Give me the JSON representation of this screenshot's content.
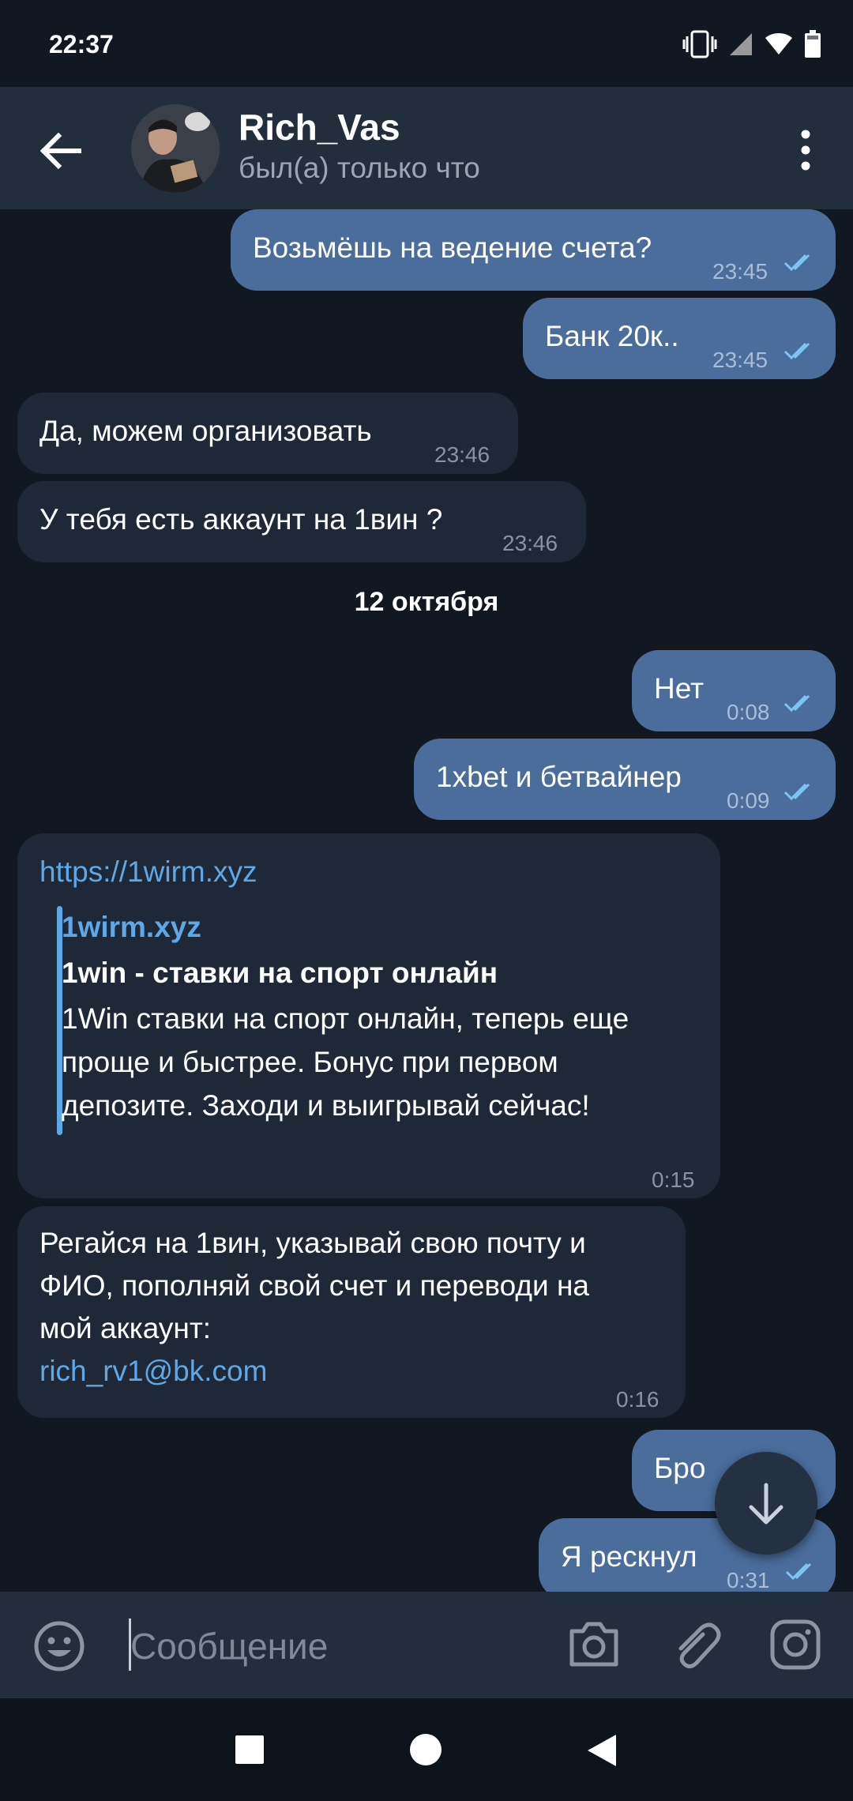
{
  "status_bar": {
    "time": "22:37"
  },
  "header": {
    "name": "Rich_Vas",
    "status": "был(а) только что"
  },
  "messages": [
    {
      "text": "Возьмёшь на ведение счета?",
      "time": "23:45"
    },
    {
      "text": "Банк 20к..",
      "time": "23:45"
    },
    {
      "text": "Да, можем организовать",
      "time": "23:46"
    },
    {
      "text": "У тебя есть аккаунт на 1вин ?",
      "time": "23:46"
    },
    {
      "text": "Нет",
      "time": "0:08"
    },
    {
      "text": "1xbet и бетвайнер",
      "time": "0:09"
    },
    {
      "link": "https://1wirm.xyz",
      "preview_site": "1wirm.xyz",
      "preview_title": "1win - ставки на спорт онлайн",
      "preview_lines": [
        "1Win ставки на спорт онлайн, теперь еще",
        "проще и быстрее. Бонус при первом",
        "депозите. Заходи и выигрывай сейчас!"
      ],
      "time": "0:15"
    },
    {
      "lines": [
        "Регайся на 1вин, указывай свою почту и",
        "ФИО, пополняй свой счет и переводи на",
        "мой аккаунт:"
      ],
      "email": "rich_rv1@bk.com",
      "time": "0:16"
    },
    {
      "text": "Бро",
      "time": ""
    },
    {
      "text": "Я рескнул",
      "time": "0:31"
    }
  ],
  "date_separator": "12 октября",
  "input": {
    "placeholder": "Сообщение"
  },
  "colors": {
    "background": "#111822",
    "header": "#232e3c",
    "outgoing_bubble": "#4a6d9b",
    "incoming_bubble": "#1f2836",
    "link": "#5fa8e8"
  },
  "icons": [
    "back-arrow-icon",
    "more-vert-icon",
    "emoji-icon",
    "camera-icon",
    "attach-icon",
    "instagram-icon",
    "scroll-down-icon",
    "double-check-icon",
    "vibrate-icon",
    "signal-icon",
    "wifi-icon",
    "battery-icon",
    "nav-square-icon",
    "nav-circle-icon",
    "nav-triangle-icon"
  ]
}
